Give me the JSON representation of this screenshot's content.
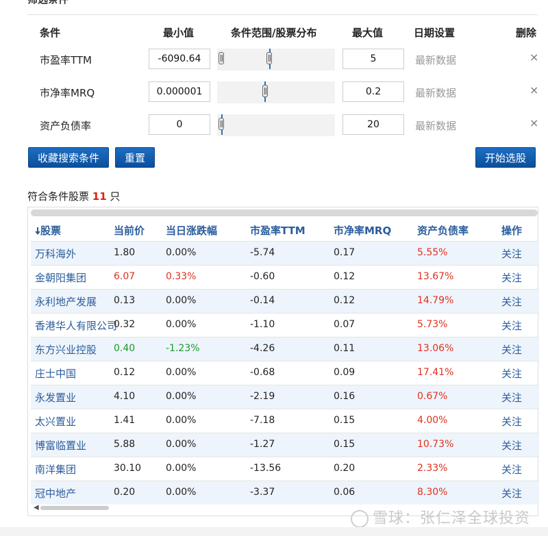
{
  "section_title": "筛选条件",
  "criteria_headers": {
    "condition": "条件",
    "min": "最小值",
    "range": "条件范围/股票分布",
    "max": "最大值",
    "date": "日期设置",
    "delete": "删除"
  },
  "criteria": [
    {
      "name": "市盈率TTM",
      "min": "-6090.64",
      "max": "5",
      "date": "最新数据"
    },
    {
      "name": "市净率MRQ",
      "min": "0.000001",
      "max": "0.2",
      "date": "最新数据"
    },
    {
      "name": "资产负债率",
      "min": "0",
      "max": "20",
      "date": "最新数据"
    }
  ],
  "delete_glyph": "×",
  "buttons": {
    "save": "收藏搜索条件",
    "reset": "重置",
    "start": "开始选股"
  },
  "result": {
    "prefix": "符合条件股票 ",
    "count": "11",
    "suffix": " 只"
  },
  "table": {
    "sort_icon": "sort-down-arrow-icon",
    "headers": [
      "股票",
      "当前价",
      "当日涨跌幅",
      "市盈率TTM",
      "市净率MRQ",
      "资产负债率",
      "操作"
    ],
    "rows": [
      {
        "name": "万科海外",
        "price": "1.80",
        "change": "0.00%",
        "pe": "-5.74",
        "pb": "0.17",
        "debt": "5.55%",
        "action": "关注",
        "trend": "flat"
      },
      {
        "name": "金朝阳集团",
        "price": "6.07",
        "change": "0.33%",
        "pe": "-0.60",
        "pb": "0.12",
        "debt": "13.67%",
        "action": "关注",
        "trend": "up"
      },
      {
        "name": "永利地产发展",
        "price": "0.13",
        "change": "0.00%",
        "pe": "-0.14",
        "pb": "0.12",
        "debt": "14.79%",
        "action": "关注",
        "trend": "flat"
      },
      {
        "name": "香港华人有限公司",
        "price": "0.32",
        "change": "0.00%",
        "pe": "-1.10",
        "pb": "0.07",
        "debt": "5.73%",
        "action": "关注",
        "trend": "flat"
      },
      {
        "name": "东方兴业控股",
        "price": "0.40",
        "change": "-1.23%",
        "pe": "-4.26",
        "pb": "0.11",
        "debt": "13.06%",
        "action": "关注",
        "trend": "down"
      },
      {
        "name": "庄士中国",
        "price": "0.12",
        "change": "0.00%",
        "pe": "-0.68",
        "pb": "0.09",
        "debt": "17.41%",
        "action": "关注",
        "trend": "flat"
      },
      {
        "name": "永发置业",
        "price": "4.10",
        "change": "0.00%",
        "pe": "-2.19",
        "pb": "0.16",
        "debt": "0.67%",
        "action": "关注",
        "trend": "flat"
      },
      {
        "name": "太兴置业",
        "price": "1.41",
        "change": "0.00%",
        "pe": "-7.18",
        "pb": "0.15",
        "debt": "4.00%",
        "action": "关注",
        "trend": "flat"
      },
      {
        "name": "博富临置业",
        "price": "5.88",
        "change": "0.00%",
        "pe": "-1.27",
        "pb": "0.15",
        "debt": "10.73%",
        "action": "关注",
        "trend": "flat"
      },
      {
        "name": "南洋集团",
        "price": "30.10",
        "change": "0.00%",
        "pe": "-13.56",
        "pb": "0.20",
        "debt": "2.33%",
        "action": "关注",
        "trend": "flat"
      },
      {
        "name": "冠中地产",
        "price": "0.20",
        "change": "0.00%",
        "pe": "-3.37",
        "pb": "0.06",
        "debt": "8.30%",
        "action": "关注",
        "trend": "flat"
      }
    ]
  },
  "watermark": "雪球：张仁泽全球投资",
  "colors": {
    "accent": "#0b4f9c",
    "up": "#e0301e",
    "down": "#1a9a2a",
    "link": "#2a5d9c",
    "row_alt": "#eef4fb"
  }
}
